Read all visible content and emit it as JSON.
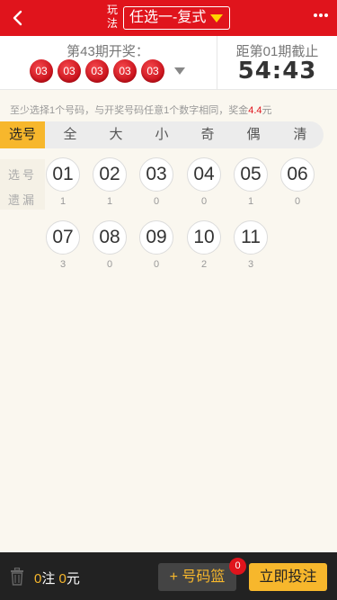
{
  "header": {
    "play_label": "玩法",
    "mode": "任选一-复式"
  },
  "draw": {
    "previous_title": "第43期开奖：",
    "balls": [
      "03",
      "03",
      "03",
      "03",
      "03"
    ],
    "close_title": "距第01期截止",
    "countdown": "54:43"
  },
  "hint": {
    "text": "至少选择1个号码，与开奖号码任意1个数字相同，奖金",
    "prize": "4.4",
    "unit": "元"
  },
  "filter": {
    "select_label": "选号",
    "options": [
      "全",
      "大",
      "小",
      "奇",
      "偶",
      "清"
    ]
  },
  "side": {
    "pick_label": "选号",
    "miss_label": "遗漏"
  },
  "numbers": [
    {
      "value": "01",
      "miss": "1"
    },
    {
      "value": "02",
      "miss": "1"
    },
    {
      "value": "03",
      "miss": "0"
    },
    {
      "value": "04",
      "miss": "0"
    },
    {
      "value": "05",
      "miss": "1"
    },
    {
      "value": "06",
      "miss": "0"
    },
    {
      "value": "07",
      "miss": "3"
    },
    {
      "value": "08",
      "miss": "0"
    },
    {
      "value": "09",
      "miss": "0"
    },
    {
      "value": "10",
      "miss": "2"
    },
    {
      "value": "11",
      "miss": "3"
    }
  ],
  "bottom": {
    "bets": "0",
    "bets_unit": "注",
    "amount": "0",
    "amount_unit": "元",
    "basket_label": "+ 号码篮",
    "basket_count": "0",
    "submit_label": "立即投注"
  },
  "icons": {
    "back": "back-arrow-icon",
    "caret": "caret-down-icon",
    "more": "more-dots-icon",
    "trash": "trash-icon"
  },
  "colors": {
    "brand_red": "#e0141c",
    "accent_gold": "#f7b72c",
    "caret_yellow": "#ffd400",
    "bottom_bar": "#222222"
  }
}
